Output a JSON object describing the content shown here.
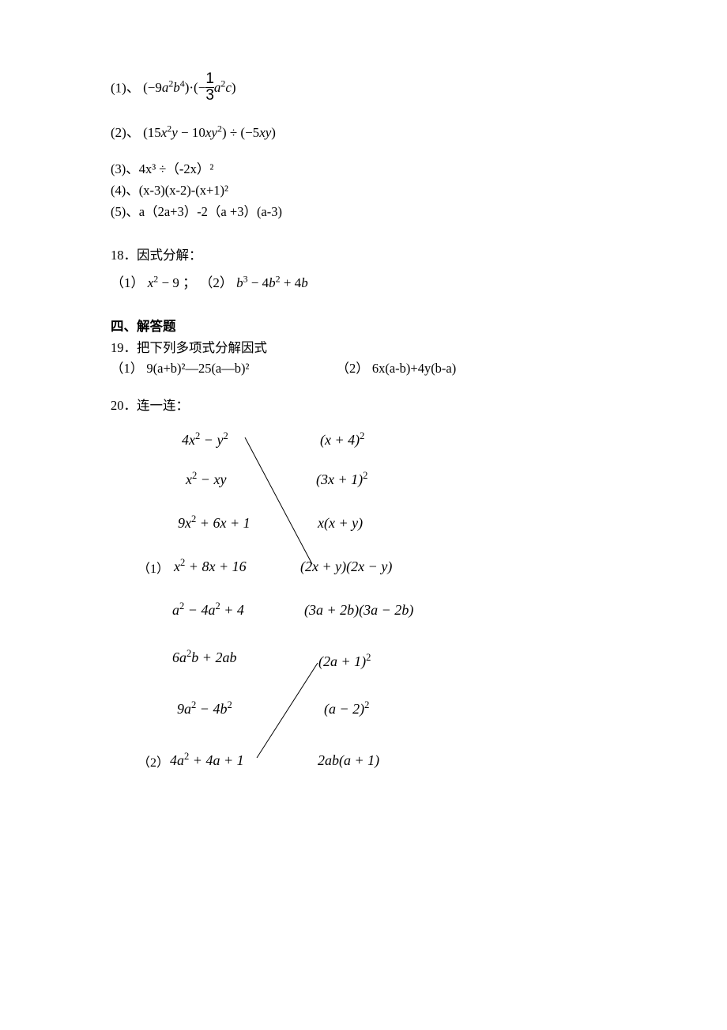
{
  "q17": {
    "p1_label": "(1)、",
    "p1_expr": "(−9a²b⁴)·(−",
    "p1_frac_num": "1",
    "p1_frac_den": "3",
    "p1_tail": "a²c)",
    "p2_label": "(2)、",
    "p2_expr": "(15x²y − 10xy²) ÷ (−5xy)",
    "p3": "(3)、4x³ ÷（-2x）²",
    "p4": "(4)、(x-3)(x-2)-(x+1)²",
    "p5": "(5)、a（2a+3）-2（a +3）(a-3)"
  },
  "q18": {
    "title": "18．因式分解：",
    "p1_label": "（1）",
    "p1_expr": "x² − 9",
    "sep": "；",
    "p2_label": "（2）",
    "p2_expr": "b³ − 4b² + 4b"
  },
  "section4": "四、解答题",
  "q19": {
    "title": "19．把下列多项式分解因式",
    "p1_label": "（1）",
    "p1_expr": "9(a+b)²—25(a—b)²",
    "p2_label": "（2）",
    "p2_expr": "6x(a-b)+4y(b-a)"
  },
  "q20": {
    "title": "20．连一连：",
    "label1": "（1）",
    "label2": "（2）",
    "left": {
      "l1": "4x² − y²",
      "l2": "x² − xy",
      "l3": "9x² + 6x + 1",
      "l4": "x² + 8x + 16",
      "l5": "a² − 4a² + 4",
      "l6": "6a²b + 2ab",
      "l7": "9a² − 4b²",
      "l8": "4a² + 4a + 1"
    },
    "right": {
      "r1": "(x + 4)²",
      "r2": "(3x + 1)²",
      "r3": "x(x + y)",
      "r4": "(2x + y)(2x − y)",
      "r5": "(3a + 2b)(3a − 2b)",
      "r6": "(2a + 1)²",
      "r7": "(a − 2)²",
      "r8": "2ab(a + 1)"
    }
  }
}
